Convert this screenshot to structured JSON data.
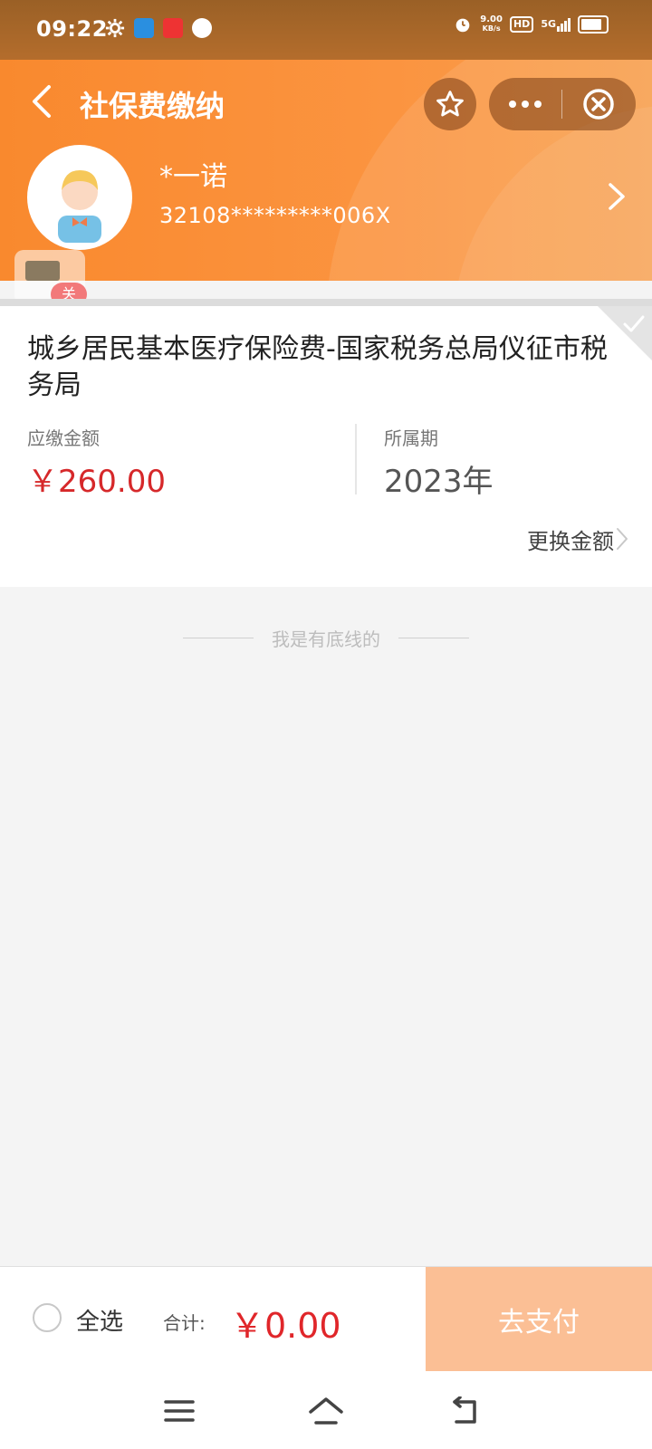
{
  "status_bar": {
    "time": "09:22",
    "net_speed_value": "9.00",
    "net_speed_unit": "KB/s",
    "hd": "HD",
    "network": "5G"
  },
  "header": {
    "title": "社保费缴纳",
    "user_name": "*一诺",
    "user_id": "32108*********006X"
  },
  "floating_widget": {
    "badge": "关"
  },
  "card": {
    "title": "城乡居民基本医疗保险费-国家税务总局仪征市税务局",
    "due_label": "应缴金额",
    "due_amount": "￥260.00",
    "period_label": "所属期",
    "period_value": "2023年",
    "change_amount": "更换金额"
  },
  "bottom_line_text": "我是有底线的",
  "footer": {
    "select_all": "全选",
    "total_label": "合计:",
    "total_amount": "￥0.00",
    "pay_button": "去支付"
  },
  "colors": {
    "header_orange": "#f9892e",
    "amount_red": "#d6282a",
    "pay_button_disabled": "#fbbf95"
  },
  "icons": [
    "back-icon",
    "star-icon",
    "more-icon",
    "close-circle-icon",
    "chevron-right-icon",
    "check-icon",
    "menu-icon",
    "home-icon",
    "back-nav-icon"
  ]
}
